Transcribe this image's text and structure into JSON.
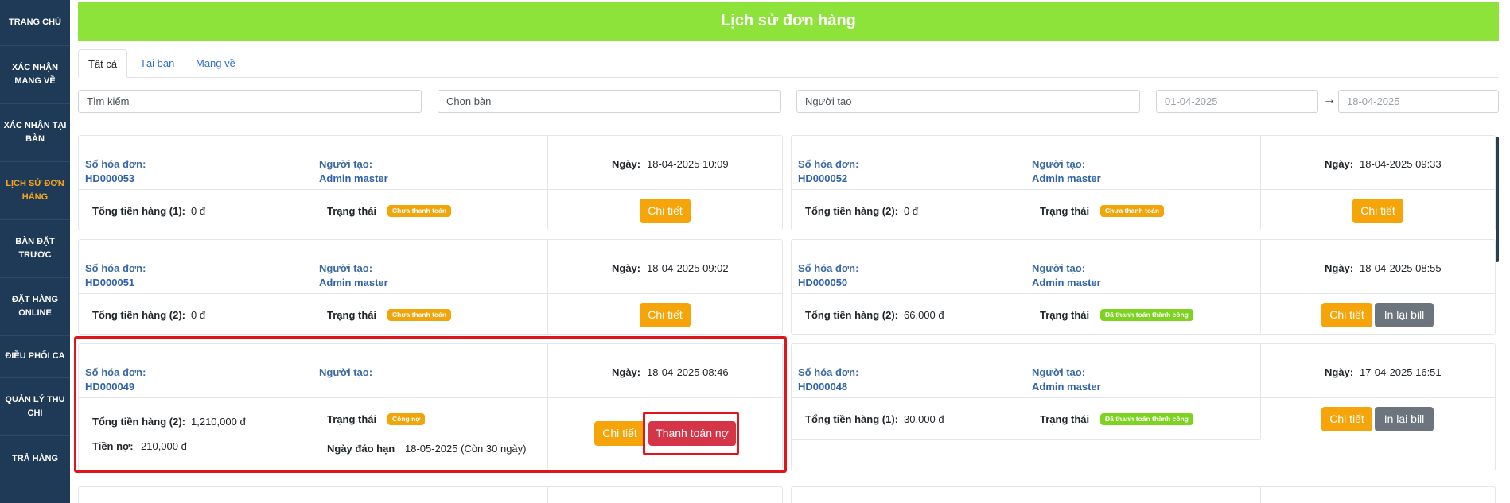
{
  "sidebar": {
    "items": [
      {
        "label": "TRANG CHỦ"
      },
      {
        "label": "XÁC NHẬN MANG VỀ"
      },
      {
        "label": "XÁC NHẬN TẠI BÀN"
      },
      {
        "label": "LỊCH SỬ ĐƠN HÀNG",
        "active": true
      },
      {
        "label": "BÀN ĐẶT TRƯỚC"
      },
      {
        "label": "ĐẶT HÀNG ONLINE"
      },
      {
        "label": "ĐIỀU PHỐI CA"
      },
      {
        "label": "QUẢN LÝ THU CHI"
      },
      {
        "label": "TRẢ HÀNG"
      }
    ]
  },
  "header": {
    "title": "Lịch sử đơn hàng"
  },
  "tabs": [
    {
      "label": "Tất cả",
      "active": true
    },
    {
      "label": "Tại bàn"
    },
    {
      "label": "Mang về"
    }
  ],
  "filters": {
    "search_placeholder": "Tìm kiếm",
    "table_placeholder": "Chọn bàn",
    "creator_placeholder": "Người tạo",
    "date_from_placeholder": "01-04-2025",
    "date_to_placeholder": "18-04-2025"
  },
  "labels": {
    "invoice_no": "Số hóa đơn:",
    "creator": "Người tạo:",
    "date": "Ngày:",
    "status": "Trạng thái",
    "debt_amount": "Tiền nợ:",
    "due_date": "Ngày đáo hạn",
    "detail_button": "Chi tiết",
    "reprint_button": "In lại bill",
    "pay_debt_button": "Thanh toán nợ"
  },
  "orders": [
    {
      "invoice": "HD000053",
      "creator": "Admin master",
      "date": "18-04-2025 10:09",
      "total_label": "Tổng tiền hàng (1):",
      "total": "0 đ",
      "status": "Chưa thanh toán",
      "status_color": "#f0a50a"
    },
    {
      "invoice": "HD000052",
      "creator": "Admin master",
      "date": "18-04-2025 09:33",
      "total_label": "Tổng tiền hàng (2):",
      "total": "0 đ",
      "status": "Chưa thanh toán",
      "status_color": "#f0a50a"
    },
    {
      "invoice": "HD000051",
      "creator": "Admin master",
      "date": "18-04-2025 09:02",
      "total_label": "Tổng tiền hàng (2):",
      "total": "0 đ",
      "status": "Chưa thanh toán",
      "status_color": "#f0a50a"
    },
    {
      "invoice": "HD000050",
      "creator": "Admin master",
      "date": "18-04-2025 08:55",
      "total_label": "Tổng tiền hàng (2):",
      "total": "66,000 đ",
      "status": "Đã thanh toán thành công",
      "status_color": "#7ed321"
    },
    {
      "invoice": "HD000049",
      "creator": "",
      "date": "18-04-2025 08:46",
      "total_label": "Tổng tiền hàng (2):",
      "total": "1,210,000 đ",
      "status": "Công nợ",
      "status_color": "#f0a50a",
      "debt": "210,000 đ",
      "due": "18-05-2025 (Còn 30 ngày)"
    },
    {
      "invoice": "HD000048",
      "creator": "Admin master",
      "date": "17-04-2025 16:51",
      "total_label": "Tổng tiền hàng (1):",
      "total": "30,000 đ",
      "status": "Đã thanh toán thành công",
      "status_color": "#7ed321"
    }
  ],
  "colors": {
    "sidebar_bg": "#1f3a57",
    "sidebar_active": "#f5a623",
    "header_bg": "#8de33a",
    "highlight_outline": "#e0141b"
  }
}
